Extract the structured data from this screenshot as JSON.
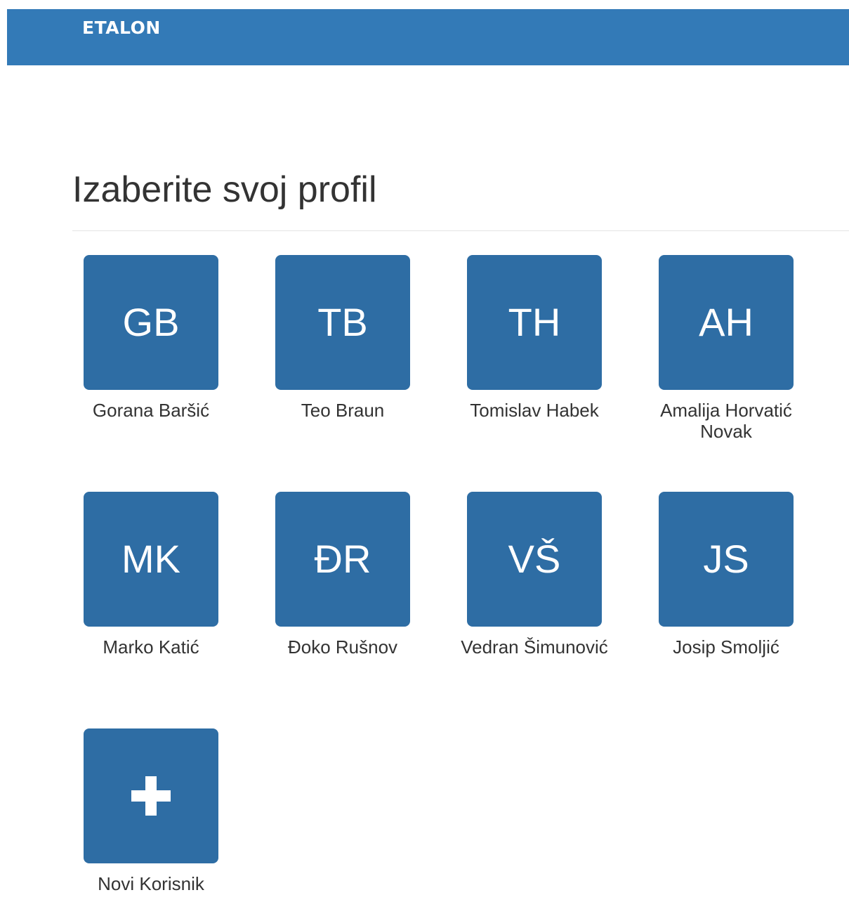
{
  "navbar": {
    "brand": "ETALON",
    "color": "#337ab7"
  },
  "main": {
    "title": "Izaberite svoj profil",
    "tile_color": "#2e6da4"
  },
  "profiles": [
    {
      "initials": "GB",
      "name": "Gorana Baršić"
    },
    {
      "initials": "TB",
      "name": "Teo Braun"
    },
    {
      "initials": "TH",
      "name": "Tomislav Habek"
    },
    {
      "initials": "AH",
      "name": "Amalija Horvatić Novak"
    },
    {
      "initials": "MK",
      "name": "Marko Katić"
    },
    {
      "initials": "ĐR",
      "name": "Đoko Rušnov"
    },
    {
      "initials": "VŠ",
      "name": "Vedran Šimunović"
    },
    {
      "initials": "JS",
      "name": "Josip Smoljić"
    }
  ],
  "new_user": {
    "icon": "plus-icon",
    "label": "Novi Korisnik"
  }
}
